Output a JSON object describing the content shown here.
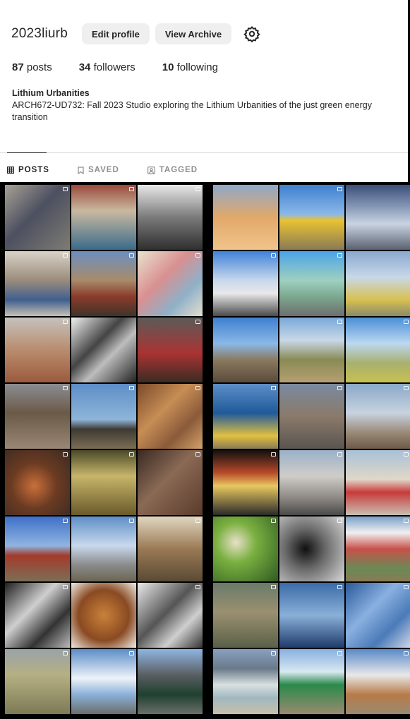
{
  "profile": {
    "username": "2023liurb",
    "edit_profile": "Edit profile",
    "view_archive": "View Archive",
    "settings_icon": "gear-icon",
    "posts_count": "87",
    "posts_label": "posts",
    "followers_count": "34",
    "followers_label": "followers",
    "following_count": "10",
    "following_label": "following",
    "bio_name": "Lithium Urbanities",
    "bio_text": "ARCH672-UD732: Fall 2023 Studio exploring the Lithium Urbanities of the just green energy transition"
  },
  "tabs": [
    {
      "label": "POSTS",
      "icon": "grid-icon",
      "active": true
    },
    {
      "label": "SAVED",
      "icon": "bookmark-icon",
      "active": false
    },
    {
      "label": "TAGGED",
      "icon": "tag-icon",
      "active": false
    }
  ],
  "grid_left": [
    {
      "bg": "linear-gradient(135deg,#a7a196 0%,#4c5060 45%,#7e7c73 100%)",
      "multi": true
    },
    {
      "bg": "linear-gradient(180deg,#9a4a3c 0%,#c9b9a0 40%,#3a6b8a 100%)",
      "multi": true
    },
    {
      "bg": "linear-gradient(180deg,#e8e8e8 0%,#7a7a7a 50%,#2f2f2f 100%)",
      "multi": true
    },
    {
      "bg": "linear-gradient(180deg,#d9d3c8 0%,#9a8c7c 45%,#3f5f8f 75%,#c7c0b3 100%)",
      "multi": true
    },
    {
      "bg": "linear-gradient(180deg,#6b8fc0 0%,#a88b6a 45%,#8a3b2b 70%,#3f3428 100%)",
      "multi": true
    },
    {
      "bg": "linear-gradient(135deg,#e9e2cf 0%,#d99090 40%,#8fb0c8 70%,#e5dfcc 100%)",
      "multi": true
    },
    {
      "bg": "linear-gradient(180deg,#c4c2bd 0%,#b98c6e 50%,#9c5a3c 100%)",
      "multi": true
    },
    {
      "bg": "linear-gradient(135deg,#f2f2f2 0%,#444 40%,#bdbdbd 60%,#222 100%)",
      "multi": false
    },
    {
      "bg": "linear-gradient(180deg,#5c5b58 0%,#a33 55%,#3a2b22 100%)",
      "multi": true
    },
    {
      "bg": "linear-gradient(180deg,#8a8d92 0%,#6b5a47 45%,#9a8777 100%)",
      "multi": true
    },
    {
      "bg": "linear-gradient(180deg,#5d8ec8 0%,#8fb5d8 55%,#3d3a32 70%,#7b6e55 100%)",
      "multi": true
    },
    {
      "bg": "linear-gradient(135deg,#7a4a2a 0%,#c78d55 40%,#8a5a3a 70%,#d2a16a 100%)",
      "multi": true
    },
    {
      "bg": "radial-gradient(circle at 45% 55%,#c96f3a 0%,#6b3b22 45%,#3a2a22 100%)",
      "multi": true
    },
    {
      "bg": "linear-gradient(180deg,#4a4a2a 0%,#c7b56a 40%,#6a5a2a 100%)",
      "multi": true
    },
    {
      "bg": "linear-gradient(135deg,#3a2a22 0%,#8a6a55 45%,#5a3a2a 100%)",
      "multi": true
    },
    {
      "bg": "linear-gradient(180deg,#3d6fc8 0%,#8fb5e0 45%,#a43b2b 60%,#7b6e55 100%)",
      "multi": true
    },
    {
      "bg": "linear-gradient(180deg,#5d8ec8 0%,#c9d9ec 45%,#8a8a8a 75%,#6b6552 100%)",
      "multi": true
    },
    {
      "bg": "linear-gradient(180deg,#e0d6c0 0%,#9a7a55 50%,#5a4a35 100%)",
      "multi": true
    },
    {
      "bg": "linear-gradient(135deg,#1f1f1f 0%,#cfcfcf 40%,#333 70%,#bbb 100%)",
      "multi": true
    },
    {
      "bg": "radial-gradient(circle at 50% 50%,#c9823a 0%,#8a4a22 55%,#f0ece6 100%)",
      "multi": false
    },
    {
      "bg": "linear-gradient(135deg,#eaeaea 0%,#555 45%,#cfcfcf 70%,#333 100%)",
      "multi": true
    },
    {
      "bg": "linear-gradient(180deg,#9aa3a8 0%,#b5b083 40%,#7c7a55 100%)",
      "multi": true
    },
    {
      "bg": "linear-gradient(180deg,#5d8ec8 0%,#eef3f8 45%,#8ab0d8 70%,#6b6e6a 100%)",
      "multi": true
    },
    {
      "bg": "linear-gradient(180deg,#8fb5e0 0%,#5a5e62 40%,#1f4030 70%,#6b6e6a 100%)",
      "multi": false
    }
  ],
  "grid_right": [
    {
      "bg": "linear-gradient(180deg,#8fa8c8 0%,#e2a86a 50%,#f0c48a 100%)",
      "multi": false
    },
    {
      "bg": "linear-gradient(180deg,#3e7fd0 0%,#8ab8e8 45%,#e8c232 55%,#8a7a55 100%)",
      "multi": true
    },
    {
      "bg": "linear-gradient(180deg,#3b4e7a 0%,#8a9bb8 35%,#c9d3e2 60%,#5a6272 100%)",
      "multi": false
    },
    {
      "bg": "linear-gradient(180deg,#3f82d8 0%,#c8d8ec 45%,#e9e9e9 65%,#4a4a4a 100%)",
      "multi": true
    },
    {
      "bg": "linear-gradient(180deg,#4ba3e8 0%,#9fd0c0 45%,#7ba890 70%,#6e6e6e 100%)",
      "multi": true
    },
    {
      "bg": "linear-gradient(180deg,#8aa8d0 0%,#c8d8e8 40%,#d8c050 75%,#8a8a6a 100%)",
      "multi": false
    },
    {
      "bg": "linear-gradient(180deg,#3f7fd0 0%,#8ab8e8 40%,#8a7a60 65%,#5a4a3a 100%)",
      "multi": false
    },
    {
      "bg": "linear-gradient(180deg,#7aa8d8 0%,#c8d8e8 35%,#8a8a55 65%,#b5a070 100%)",
      "multi": true
    },
    {
      "bg": "linear-gradient(180deg,#4a90d8 0%,#bcd8f0 40%,#a8b070 70%,#c8c050 100%)",
      "multi": true
    },
    {
      "bg": "linear-gradient(180deg,#5d8ec8 0%,#1f5a9a 45%,#e0c040 80%,#8a7a55 100%)",
      "multi": true
    },
    {
      "bg": "linear-gradient(180deg,#7a8aa0 0%,#8a7a6a 50%,#5a5550 100%)",
      "multi": true
    },
    {
      "bg": "linear-gradient(180deg,#8aa8c8 0%,#c8d3e0 45%,#9a8a78 75%,#6e5a48 100%)",
      "multi": true
    },
    {
      "bg": "linear-gradient(180deg,#101010 0%,#b84a2a 35%,#e8c860 55%,#2a2a2a 100%)",
      "multi": true
    },
    {
      "bg": "linear-gradient(180deg,#9ab0c8 0%,#d0cdc8 40%,#8a8580 75%,#4a4a4a 100%)",
      "multi": true
    },
    {
      "bg": "linear-gradient(180deg,#a8c0d8 0%,#e0d8c8 45%,#c83a3a 65%,#c8c0b0 100%)",
      "multi": true
    },
    {
      "bg": "radial-gradient(circle at 35% 40%,#e8e0c8 0%,#7ab040 35%,#2f5a22 100%)",
      "multi": true
    },
    {
      "bg": "radial-gradient(circle at 40% 50%,#101010 0%,#6a6a6a 40%,#d8d8d8 100%)",
      "multi": true
    },
    {
      "bg": "linear-gradient(180deg,#7aa0c8 0%,#f0f0f0 25%,#c8504a 50%,#6a8a55 80%,#8a7a55 100%)",
      "multi": true
    },
    {
      "bg": "linear-gradient(180deg,#6a7a6a 0%,#9a9070 45%,#5a6048 100%)",
      "multi": true
    },
    {
      "bg": "linear-gradient(180deg,#3a6aa8 0%,#8ab0d8 50%,#1f3a6a 100%)",
      "multi": true
    },
    {
      "bg": "linear-gradient(135deg,#2a5a9a 0%,#8ab0e0 40%,#4a7ab8 70%,#cfd8e8 100%)",
      "multi": true
    },
    {
      "bg": "linear-gradient(180deg,#8aa0c0 0%,#6a7a8a 30%,#d8e0e0 55%,#a0b8c0 75%,#c8c0a8 100%)",
      "multi": true
    },
    {
      "bg": "linear-gradient(180deg,#8ab0e0 0%,#d8e8f0 35%,#2a8a4a 55%,#9a8a70 100%)",
      "multi": true
    },
    {
      "bg": "linear-gradient(180deg,#5a8ac8 0%,#e8e8e8 40%,#b87a4a 70%,#9a8a70 100%)",
      "multi": true
    }
  ]
}
